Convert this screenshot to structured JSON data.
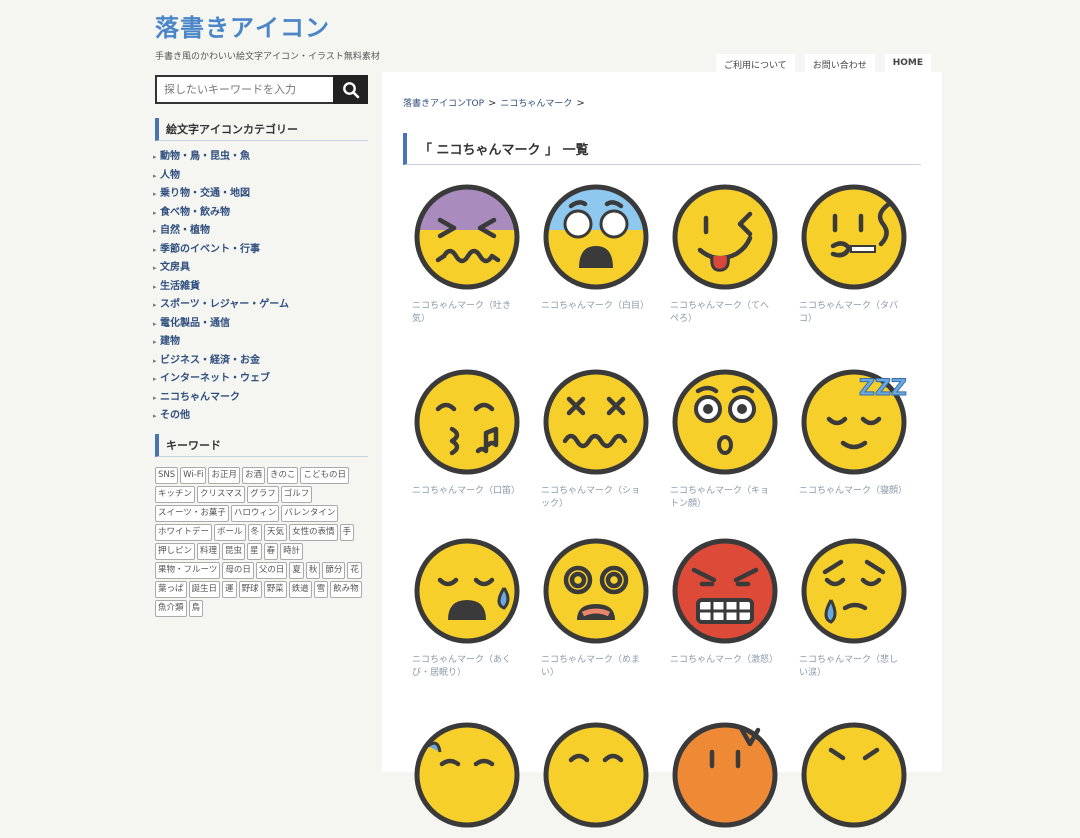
{
  "site": {
    "logo": "落書きアイコン",
    "tagline": "手書き風のかわいい絵文字アイコン・イラスト無料素材"
  },
  "topnav": [
    "ご利用について",
    "お問い合わせ",
    "HOME"
  ],
  "search": {
    "placeholder": "探したいキーワードを入力"
  },
  "sidebar": {
    "category_heading": "絵文字アイコンカテゴリー",
    "categories": [
      "動物・鳥・昆虫・魚",
      "人物",
      "乗り物・交通・地図",
      "食べ物・飲み物",
      "自然・植物",
      "季節のイベント・行事",
      "文房具",
      "生活雑貨",
      "スポーツ・レジャー・ゲーム",
      "電化製品・通信",
      "建物",
      "ビジネス・経済・お金",
      "インターネット・ウェブ",
      "ニコちゃんマーク",
      "その他"
    ],
    "keyword_heading": "キーワード",
    "tags": [
      "SNS",
      "Wi-Fi",
      "お正月",
      "お酒",
      "きのこ",
      "こどもの日",
      "キッチン",
      "クリスマス",
      "グラフ",
      "ゴルフ",
      "スイーツ・お菓子",
      "ハロウィン",
      "バレンタイン",
      "ホワイトデー",
      "ボール",
      "冬",
      "天気",
      "女性の表情",
      "手",
      "押しピン",
      "料理",
      "昆虫",
      "星",
      "春",
      "時計",
      "果物・フルーツ",
      "母の日",
      "父の日",
      "夏",
      "秋",
      "節分",
      "花",
      "葉っぱ",
      "誕生日",
      "運",
      "野球",
      "野菜",
      "鉄道",
      "雪",
      "飲み物",
      "魚介類",
      "鳥"
    ]
  },
  "breadcrumb": {
    "home": "落書きアイコンTOP",
    "sep": ">",
    "current": "ニコちゃんマーク"
  },
  "page_title": "「 ニコちゃんマーク 」 一覧",
  "icons": [
    {
      "caption": "ニコちゃんマーク（吐き気）",
      "icon": "nauseated-face-icon"
    },
    {
      "caption": "ニコちゃんマーク（白目）",
      "icon": "fearful-face-icon"
    },
    {
      "caption": "ニコちゃんマーク（てへぺろ）",
      "icon": "winking-tongue-face-icon"
    },
    {
      "caption": "ニコちゃんマーク（タバコ）",
      "icon": "smoking-face-icon"
    },
    {
      "caption": "ニコちゃんマーク（口笛）",
      "icon": "whistling-face-icon"
    },
    {
      "caption": "ニコちゃんマーク（ショック）",
      "icon": "shocked-face-icon"
    },
    {
      "caption": "ニコちゃんマーク（キョトン顔）",
      "icon": "blank-stare-face-icon"
    },
    {
      "caption": "ニコちゃんマーク（寝顔）",
      "icon": "sleeping-face-icon"
    },
    {
      "caption": "ニコちゃんマーク（あくび・居眠り）",
      "icon": "yawning-face-icon"
    },
    {
      "caption": "ニコちゃんマーク（めまい）",
      "icon": "dizzy-face-icon"
    },
    {
      "caption": "ニコちゃんマーク（激怒）",
      "icon": "furious-face-icon"
    },
    {
      "caption": "ニコちゃんマーク（悲しい涙）",
      "icon": "crying-face-icon"
    },
    {
      "caption": "",
      "icon": "sweat-face-icon"
    },
    {
      "caption": "",
      "icon": "smiling-face-icon"
    },
    {
      "caption": "",
      "icon": "angry-orange-face-icon"
    },
    {
      "caption": "",
      "icon": "squinting-face-icon"
    }
  ],
  "colors": {
    "accent": "#4a73b5",
    "face": "#f7cf2b",
    "outline": "#3a3a3a"
  }
}
